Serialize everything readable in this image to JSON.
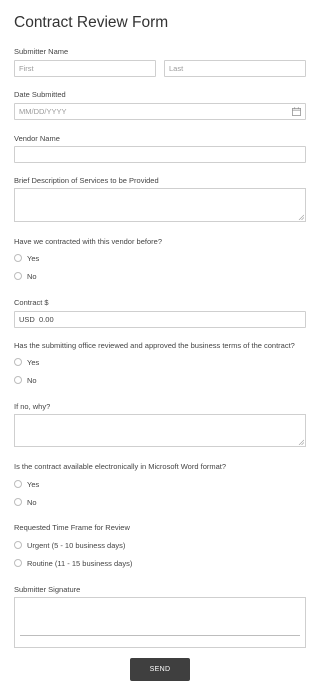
{
  "form": {
    "title": "Contract Review Form",
    "submitter_name": {
      "label": "Submitter Name",
      "first_placeholder": "First",
      "last_placeholder": "Last"
    },
    "date_submitted": {
      "label": "Date Submitted",
      "placeholder": "MM/DD/YYYY",
      "icon": "calendar-icon"
    },
    "vendor_name": {
      "label": "Vendor Name",
      "value": ""
    },
    "description": {
      "label": "Brief Description of Services to be Provided"
    },
    "contracted_before": {
      "label": "Have we contracted with this vendor before?",
      "options": [
        "Yes",
        "No"
      ]
    },
    "contract_amount": {
      "label": "Contract $",
      "currency": "USD",
      "value": "0.00"
    },
    "office_reviewed": {
      "label": "Has the submitting office reviewed and approved the business terms of the contract?",
      "options": [
        "Yes",
        "No"
      ]
    },
    "if_no_why": {
      "label": "If no, why?"
    },
    "word_format": {
      "label": "Is the contract available electronically in Microsoft Word format?",
      "options": [
        "Yes",
        "No"
      ]
    },
    "time_frame": {
      "label": "Requested Time Frame for Review",
      "options": [
        "Urgent (5 - 10 business days)",
        "Routine (11 - 15 business days)"
      ]
    },
    "signature": {
      "label": "Submitter Signature"
    },
    "send_label": "SEND"
  }
}
